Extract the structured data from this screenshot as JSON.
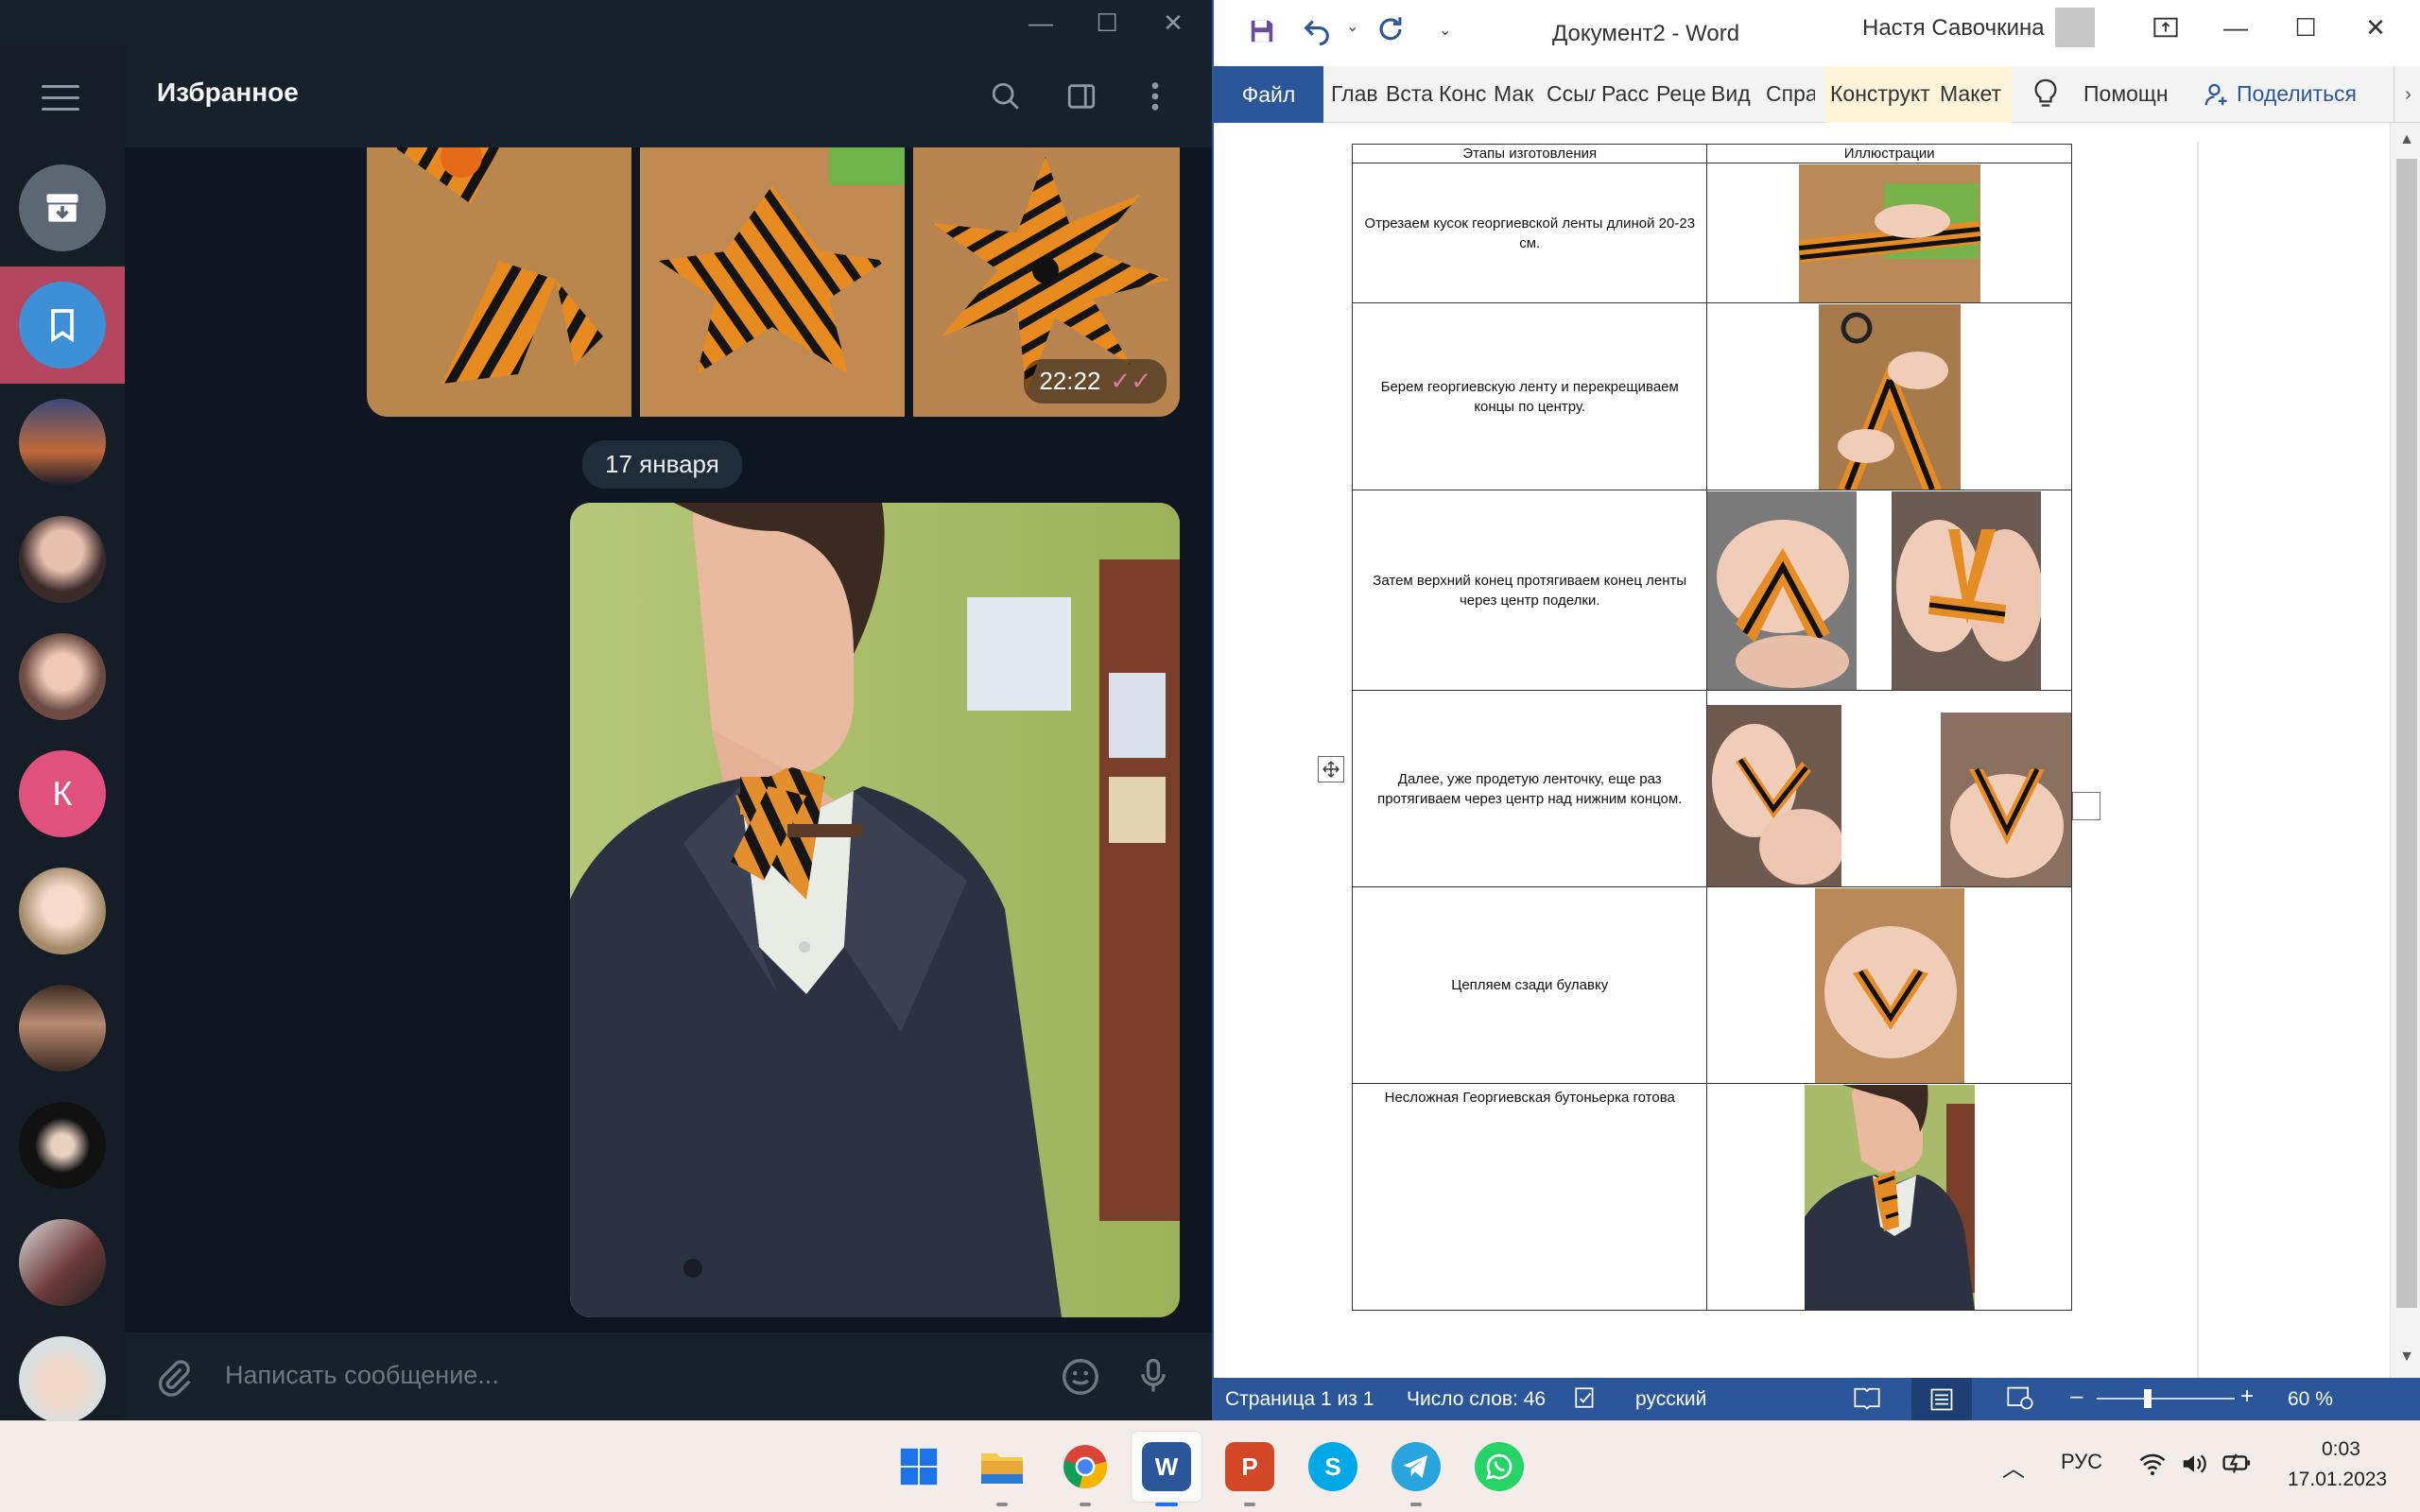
{
  "telegram": {
    "window_controls": {
      "minimize": "—",
      "maximize": "☐",
      "close": "✕"
    },
    "header_title": "Избранное",
    "chat_avatars": [
      {
        "name": "archive",
        "color": "#5b6773"
      },
      {
        "name": "saved",
        "color": "#3d8fd6"
      },
      {
        "name": "sunset",
        "color": "#2f3a55"
      },
      {
        "name": "girl-1",
        "color": "#4a3a3a"
      },
      {
        "name": "girl-2",
        "color": "#6b4b42"
      },
      {
        "name": "k",
        "letter": "К",
        "color": "#e0517d"
      },
      {
        "name": "girl-3",
        "color": "#a58a6a"
      },
      {
        "name": "eyes",
        "color": "#5d4036"
      },
      {
        "name": "dark",
        "color": "#222222"
      },
      {
        "name": "selfie",
        "color": "#6d3a3a"
      },
      {
        "name": "boy",
        "color": "#d8dfe0"
      }
    ],
    "album_time": "22:22",
    "date_separator": "17 января",
    "composer_placeholder": "Написать сообщение..."
  },
  "word": {
    "doc_title": "Документ2  -  Word",
    "user_name": "Настя Савочкина",
    "tabs": {
      "file": "Файл",
      "home": "Глав",
      "insert": "Вста",
      "design": "Конс",
      "layout": "Мак",
      "references": "Ссыл",
      "mailings": "Расс",
      "review": "Реце",
      "view": "Вид",
      "help": "Спра",
      "table_design": "Конструкт",
      "table_layout": "Макет",
      "tell_me": "Помощн",
      "share": "Поделиться"
    },
    "table": {
      "headers": [
        "Этапы изготовления",
        "Иллюстрации"
      ],
      "rows": [
        "Отрезаем кусок георгиевской ленты длиной 20-23 см.",
        "Берем георгиевскую ленту и перекрещиваем концы по центру.",
        "Затем верхний конец протягиваем конец ленты через центр поделки.",
        "Далее, уже продетую ленточку, еще раз протягиваем через центр над нижним концом.",
        "Цепляем сзади булавку",
        "Несложная Георгиевская бутоньерка готова"
      ]
    },
    "status": {
      "page": "Страница 1 из 1",
      "words": "Число слов: 46",
      "language": "русский",
      "zoom": "60 %"
    }
  },
  "taskbar": {
    "apps": [
      {
        "name": "start",
        "glyph": ""
      },
      {
        "name": "explorer",
        "glyph": ""
      },
      {
        "name": "chrome",
        "glyph": ""
      },
      {
        "name": "word",
        "glyph": "W"
      },
      {
        "name": "powerpoint",
        "glyph": "P"
      },
      {
        "name": "skype",
        "glyph": "S"
      },
      {
        "name": "telegram",
        "glyph": ""
      },
      {
        "name": "whatsapp",
        "glyph": ""
      }
    ],
    "language": "РУС",
    "time": "0:03",
    "date": "17.01.2023"
  }
}
